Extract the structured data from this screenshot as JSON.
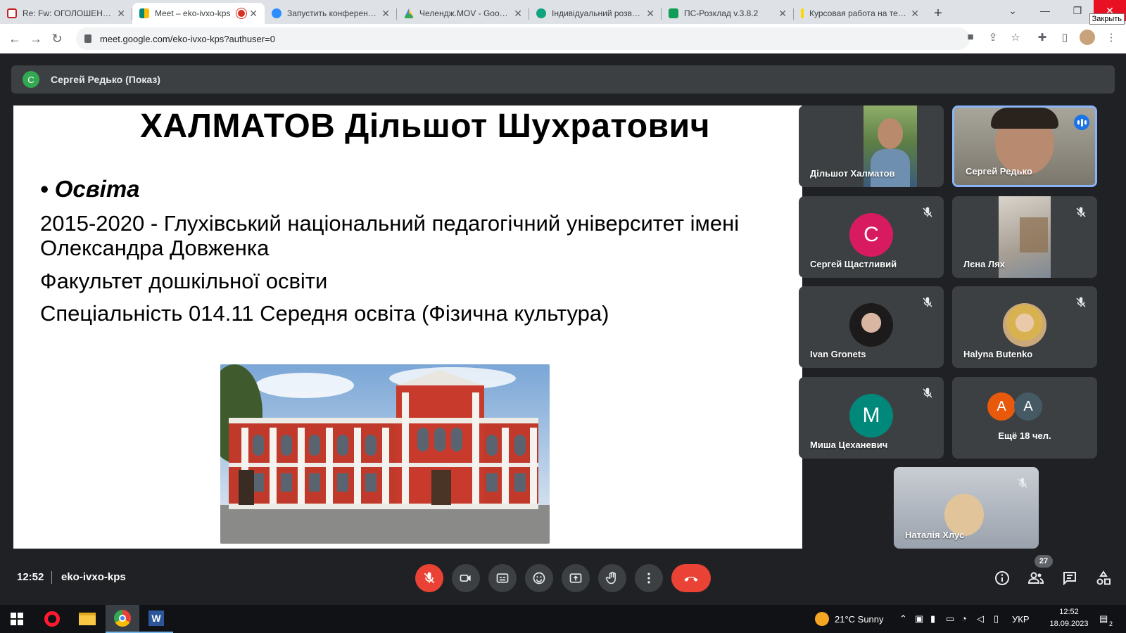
{
  "browser": {
    "tabs": [
      {
        "title": "Re: Fw: ОГОЛОШЕННЯ",
        "favicon_color": "#c5221f",
        "active": false
      },
      {
        "title": "Meet – eko-ivxo-kps",
        "favicon_color": "#00897b",
        "active": true
      },
      {
        "title": "Запустить конференцию",
        "favicon_color": "#2d8cff",
        "active": false
      },
      {
        "title": "Челендж.MOV - Google",
        "favicon_color": "#fbbc04",
        "active": false
      },
      {
        "title": "Індивідуальний розвиток",
        "favicon_color": "#10a37f",
        "active": false
      },
      {
        "title": "ПС-Розклад v.3.8.2",
        "favicon_color": "#0f9d58",
        "active": false
      },
      {
        "title": "Курсовая работа на тему",
        "favicon_color": "#ffd600",
        "active": false
      }
    ],
    "url": "meet.google.com/eko-ivxo-kps?authuser=0",
    "close_tooltip": "Закрыть"
  },
  "meet": {
    "presenter_initial": "С",
    "presenter_label": "Сергей Редько (Показ)",
    "slide": {
      "title": "ХАЛМАТОВ Дільшот Шухратович",
      "bullet": "• Освіта",
      "lines": [
        "2015-2020 - Глухівський національний педагогічний університет імені Олександра Довженка",
        "Факультет дошкільної освіти",
        "Спеціальність 014.11 Середня освіта (Фізична культура)"
      ]
    },
    "participants": [
      {
        "name": "Дільшот Халматов",
        "type": "video",
        "muted": false
      },
      {
        "name": "Сергей Редько",
        "type": "video",
        "muted": false,
        "speaking": true
      },
      {
        "name": "Сергей Щастливий",
        "type": "initial",
        "initial": "С",
        "color": "#d81b60",
        "muted": true
      },
      {
        "name": "Лєна Лях",
        "type": "video",
        "muted": true
      },
      {
        "name": "Ivan Gronets",
        "type": "photo",
        "muted": true
      },
      {
        "name": "Halyna Butenko",
        "type": "photo",
        "muted": true
      },
      {
        "name": "Миша Цеханевич",
        "type": "initial",
        "initial": "М",
        "color": "#00897b",
        "muted": true
      },
      {
        "name": "Наталія Хлус",
        "type": "video",
        "muted": true
      }
    ],
    "more": {
      "label": "Ещё 18 чел.",
      "initials": [
        "A",
        "A"
      ],
      "colors": [
        "#e8590c",
        "#455a64"
      ]
    },
    "time": "12:52",
    "meeting_code": "eko-ivxo-kps",
    "participant_count": "27"
  },
  "taskbar": {
    "weather": "21°C  Sunny",
    "lang": "УКР",
    "time": "12:52",
    "date": "18.09.2023",
    "notifications": "2"
  }
}
